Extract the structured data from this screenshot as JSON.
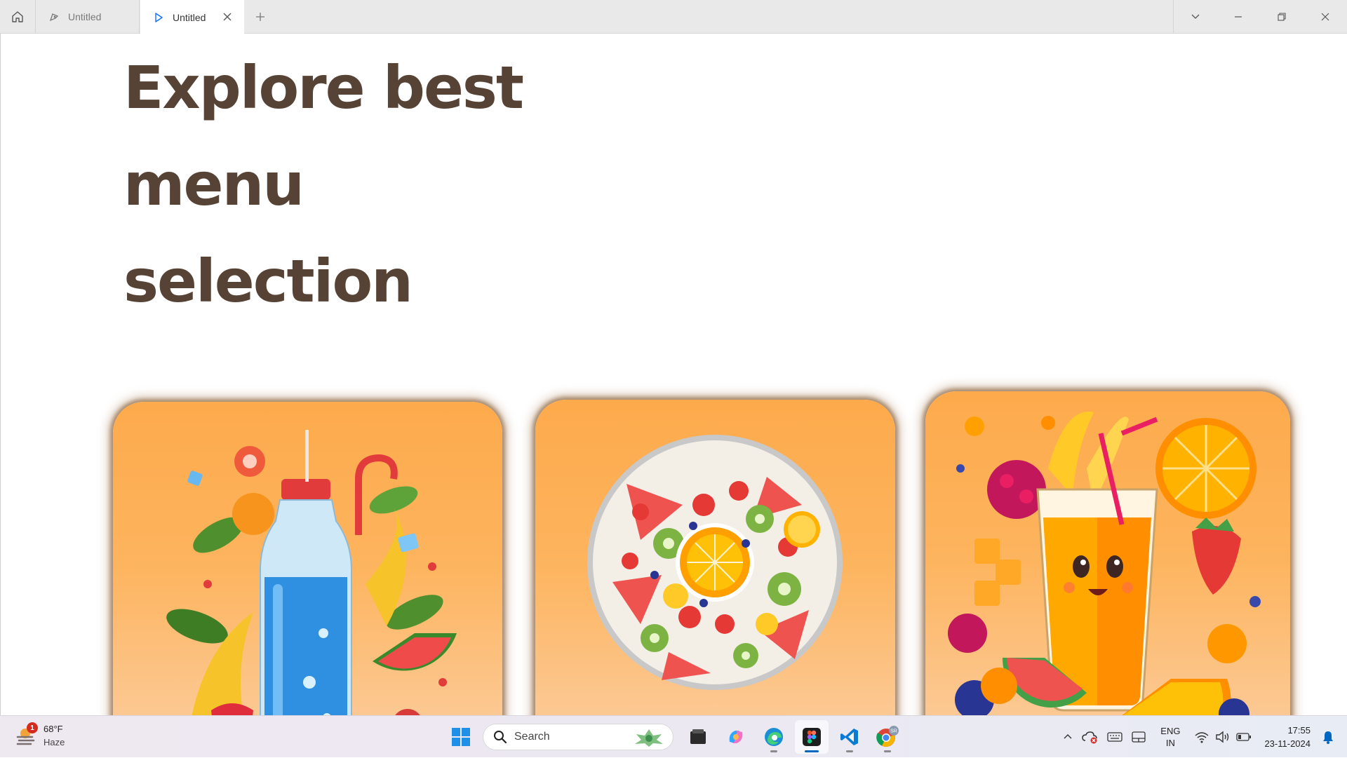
{
  "titlebar": {
    "tabs": [
      {
        "label": "Untitled",
        "icon": "figma-draft-icon",
        "active": false
      },
      {
        "label": "Untitled",
        "icon": "play-prototype-icon",
        "active": true
      }
    ]
  },
  "page": {
    "heading_lines": [
      "Explore best",
      "menu",
      "selection"
    ],
    "heading_color": "#574336",
    "card_color": "#fdaa4c",
    "cards": [
      {
        "name": "fruit-bottle-drink-card"
      },
      {
        "name": "fruit-salad-plate-card"
      },
      {
        "name": "fruit-juice-glass-card"
      }
    ]
  },
  "taskbar": {
    "weather": {
      "badge": "1",
      "temp": "68°F",
      "condition": "Haze"
    },
    "search": {
      "placeholder": "Search"
    },
    "pinned_apps": [
      "windows-start-icon",
      "file-explorer-icon",
      "copilot-icon",
      "edge-icon",
      "figma-icon",
      "vscode-icon",
      "chrome-icon"
    ],
    "language": {
      "line1": "ENG",
      "line2": "IN"
    },
    "clock": {
      "time": "17:55",
      "date": "23-11-2024"
    },
    "chrome_profile_badge": "SR"
  }
}
